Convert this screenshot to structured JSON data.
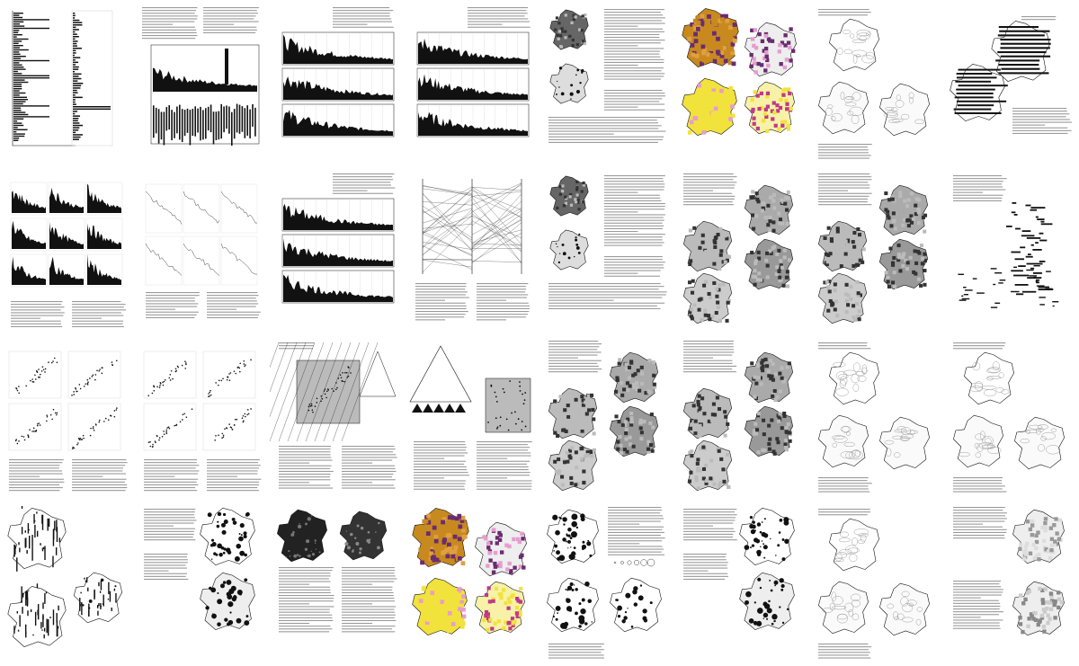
{
  "document": {
    "type": "book spread thumbnails",
    "columns": 8,
    "rows": 4,
    "colors": {
      "ink": "#111111",
      "text_gray": "#9a9a9a",
      "light_gray": "#cfcfcf",
      "magenta": "#c2388a",
      "yellow": "#f2e23c",
      "ochre": "#c88a1e",
      "pink": "#e79ccf",
      "purple": "#6a2c70"
    }
  },
  "pages": [
    {
      "row": 1,
      "col": 1,
      "kind": "bar-chart-horizontal"
    },
    {
      "row": 1,
      "col": 2,
      "kind": "text-and-time-series"
    },
    {
      "row": 1,
      "col": 3,
      "kind": "time-series-stack"
    },
    {
      "row": 1,
      "col": 4,
      "kind": "time-series-stack"
    },
    {
      "row": 1,
      "col": 5,
      "kind": "text-and-maps"
    },
    {
      "row": 1,
      "col": 6,
      "kind": "color-maps"
    },
    {
      "row": 1,
      "col": 7,
      "kind": "relief-maps"
    },
    {
      "row": 1,
      "col": 8,
      "kind": "stripe-maps"
    },
    {
      "row": 2,
      "col": 1,
      "kind": "series-grid"
    },
    {
      "row": 2,
      "col": 2,
      "kind": "line-grid"
    },
    {
      "row": 2,
      "col": 3,
      "kind": "time-series-stack"
    },
    {
      "row": 2,
      "col": 4,
      "kind": "parallel-lines"
    },
    {
      "row": 2,
      "col": 5,
      "kind": "text-and-maps"
    },
    {
      "row": 2,
      "col": 6,
      "kind": "gray-maps"
    },
    {
      "row": 2,
      "col": 7,
      "kind": "gray-maps"
    },
    {
      "row": 2,
      "col": 8,
      "kind": "text-and-bars"
    },
    {
      "row": 3,
      "col": 1,
      "kind": "scatter-plots"
    },
    {
      "row": 3,
      "col": 2,
      "kind": "scatter-plots"
    },
    {
      "row": 3,
      "col": 3,
      "kind": "diagonal-scatter"
    },
    {
      "row": 3,
      "col": 4,
      "kind": "triangle-diagram"
    },
    {
      "row": 3,
      "col": 5,
      "kind": "gray-maps"
    },
    {
      "row": 3,
      "col": 6,
      "kind": "gray-maps"
    },
    {
      "row": 3,
      "col": 7,
      "kind": "relief-maps"
    },
    {
      "row": 3,
      "col": 8,
      "kind": "relief-maps"
    },
    {
      "row": 4,
      "col": 1,
      "kind": "bar-maps"
    },
    {
      "row": 4,
      "col": 2,
      "kind": "symbol-maps"
    },
    {
      "row": 4,
      "col": 3,
      "kind": "dark-maps"
    },
    {
      "row": 4,
      "col": 4,
      "kind": "color-maps"
    },
    {
      "row": 4,
      "col": 5,
      "kind": "circle-maps"
    },
    {
      "row": 4,
      "col": 6,
      "kind": "symbol-maps"
    },
    {
      "row": 4,
      "col": 7,
      "kind": "relief-maps"
    },
    {
      "row": 4,
      "col": 8,
      "kind": "cell-maps"
    }
  ]
}
